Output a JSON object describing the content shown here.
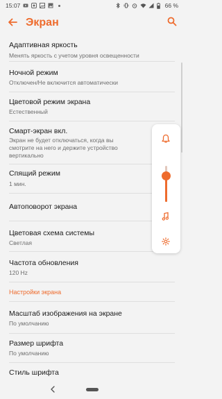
{
  "status_bar": {
    "time": "15:07",
    "battery": "66 %",
    "left_icons": [
      "youtube-icon",
      "notification-icon",
      "gallery-icon",
      "image-icon",
      "dot-icon"
    ],
    "right_icons": [
      "bluetooth-icon",
      "vibrate-icon",
      "alarm-icon",
      "wifi-icon",
      "signal-icon",
      "battery-icon"
    ]
  },
  "header": {
    "title": "Экран",
    "back_icon": "back-arrow-icon",
    "search_icon": "search-icon"
  },
  "colors": {
    "accent": "#ee6b2d",
    "background": "#f3f3f3",
    "text_primary": "#1b1b1b",
    "text_secondary": "#6e6e6e"
  },
  "settings": {
    "items": [
      {
        "title": "Адаптивная яркость",
        "summary": "Менять яркость с учетом уровня освещенности"
      },
      {
        "title": "Ночной режим",
        "summary": "Отключен/Не включится автоматически"
      },
      {
        "title": "Цветовой режим экрана",
        "summary": "Естественный"
      },
      {
        "title": "Смарт-экран вкл.",
        "summary_lines": [
          "Экран не будет отключаться, когда вы",
          "смотрите на него и держите устройство",
          "вертикально"
        ]
      },
      {
        "title": "Спящий режим",
        "summary": "1 мин."
      },
      {
        "title": "Автоповорот экрана"
      },
      {
        "title": "Цветовая схема системы",
        "summary": "Светлая"
      },
      {
        "title": "Частота обновления",
        "summary": "120 Hz"
      }
    ],
    "section_header": "Настройки экрана",
    "section_items": [
      {
        "title": "Масштаб изображения на экране",
        "summary": "По умолчанию"
      },
      {
        "title": "Размер шрифта",
        "summary": "По умолчанию"
      },
      {
        "title": "Стиль шрифта"
      }
    ]
  },
  "volume_panel": {
    "top_icon": "bell-icon",
    "slider_icon": "music-note-icon",
    "bottom_icon": "gear-icon",
    "level": 0.72
  },
  "nav_bar": {
    "back_icon": "nav-back-icon",
    "home_icon": "nav-home-pill"
  }
}
